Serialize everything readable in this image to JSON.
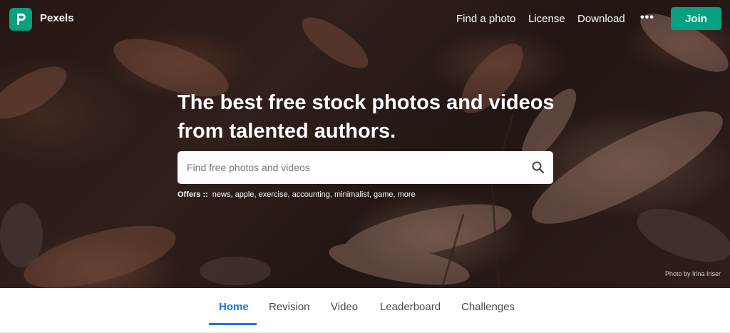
{
  "brand": {
    "name": "Pexels",
    "accent": "#05a081"
  },
  "nav": {
    "links": [
      "Find a photo",
      "License",
      "Download"
    ],
    "more_icon": "more-dots-icon",
    "more_text": "•••",
    "join_label": "Join"
  },
  "hero": {
    "headline": "The best free stock photos and videos from talented authors.",
    "search_placeholder": "Find free photos and videos",
    "search_icon": "search-icon",
    "offers_label": "Offers ::",
    "offers_items": "news, apple, exercise, accounting, minimalist, game, more",
    "photo_credit": "Photo by Irina Iriser"
  },
  "tabs": {
    "items": [
      "Home",
      "Revision",
      "Video",
      "Leaderboard",
      "Challenges"
    ],
    "active": "Home",
    "active_color": "#1a73e8"
  }
}
